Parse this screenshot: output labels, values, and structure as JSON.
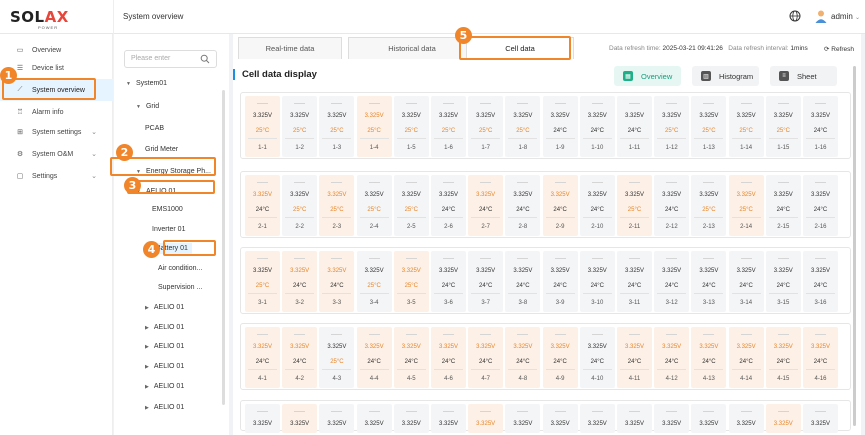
{
  "brand": {
    "name_prefix": "SOL",
    "name_suffix": "AX",
    "tagline": "POWER"
  },
  "header": {
    "page_title": "System overview",
    "user": "admin"
  },
  "sidebar": {
    "items": [
      {
        "label": "Overview",
        "icon": "monitor-icon",
        "has_submenu": false
      },
      {
        "label": "Device list",
        "icon": "list-icon",
        "has_submenu": false
      },
      {
        "label": "System overview",
        "icon": "chart-icon",
        "has_submenu": false
      },
      {
        "label": "Alarm info",
        "icon": "alarm-icon",
        "has_submenu": false
      },
      {
        "label": "System settings",
        "icon": "settings-grid-icon",
        "has_submenu": true
      },
      {
        "label": "System O&M",
        "icon": "maintenance-icon",
        "has_submenu": true
      },
      {
        "label": "Settings",
        "icon": "folder-icon",
        "has_submenu": true
      }
    ]
  },
  "tree": {
    "search_placeholder": "Please enter",
    "nodes": [
      {
        "label": "System01",
        "caret": "▼"
      },
      {
        "label": "Grid",
        "caret": "▼"
      },
      {
        "label": "PCAB",
        "caret": ""
      },
      {
        "label": "Grid Meter",
        "caret": ""
      },
      {
        "label": "Energy Storage Ph...",
        "caret": "▼"
      },
      {
        "label": "AELIO 01",
        "caret": "▼"
      },
      {
        "label": "EMS1000",
        "caret": ""
      },
      {
        "label": "Inverter 01",
        "caret": ""
      },
      {
        "label": "Battery 01",
        "caret": ""
      },
      {
        "label": "Air condition...",
        "caret": ""
      },
      {
        "label": "Supervision ...",
        "caret": ""
      },
      {
        "label": "AELIO 01",
        "caret": "▶"
      },
      {
        "label": "AELIO 01",
        "caret": "▶"
      },
      {
        "label": "AELIO 01",
        "caret": "▶"
      },
      {
        "label": "AELIO 01",
        "caret": "▶"
      },
      {
        "label": "AELIO 01",
        "caret": "▶"
      },
      {
        "label": "AELIO 01",
        "caret": "▶"
      }
    ]
  },
  "tabs": [
    "Real-time data",
    "Historical data",
    "Cell data"
  ],
  "refresh": {
    "time_label": "Data refresh time:",
    "time_value": "2025-03-21 09:41:26",
    "interval_label": "Data refresh interval:",
    "interval_value": "1mins",
    "button": "Refresh"
  },
  "section_title": "Cell data display",
  "views": [
    "Overview",
    "Histogram",
    "Sheet"
  ],
  "step_badges": [
    "1",
    "2",
    "3",
    "4",
    "5"
  ],
  "colors": {
    "accent": "#1a8fe3",
    "highlight": "#f0852a",
    "warning_text": "#e8862a",
    "hot_cell_bg": "#fdf0e6",
    "active_view": "#1fb08a"
  },
  "cells": {
    "voltage": "3.325V",
    "temp_warm": "25°C",
    "temp_normal": "24°C",
    "rows": [
      {
        "hot": [
          1,
          0,
          0,
          1,
          0,
          0,
          0,
          0,
          0,
          0,
          0,
          0,
          0,
          0,
          0,
          0
        ],
        "vwarn": [
          0,
          0,
          0,
          1,
          0,
          0,
          0,
          0,
          0,
          0,
          0,
          0,
          0,
          0,
          0,
          0
        ],
        "twarm": [
          1,
          1,
          1,
          1,
          1,
          1,
          1,
          1,
          0,
          0,
          0,
          1,
          1,
          1,
          1,
          0
        ]
      },
      {
        "hot": [
          1,
          0,
          1,
          0,
          0,
          0,
          1,
          0,
          1,
          0,
          1,
          0,
          0,
          1,
          0,
          0
        ],
        "vwarn": [
          1,
          0,
          1,
          0,
          0,
          0,
          1,
          0,
          1,
          0,
          0,
          0,
          0,
          1,
          0,
          0
        ],
        "twarm": [
          0,
          1,
          1,
          1,
          1,
          0,
          0,
          0,
          0,
          0,
          1,
          0,
          1,
          1,
          0,
          0
        ]
      },
      {
        "hot": [
          1,
          1,
          1,
          0,
          1,
          0,
          0,
          0,
          0,
          0,
          0,
          0,
          0,
          0,
          0,
          0
        ],
        "vwarn": [
          0,
          1,
          1,
          0,
          1,
          0,
          0,
          0,
          0,
          0,
          0,
          0,
          0,
          0,
          0,
          0
        ],
        "twarm": [
          1,
          0,
          0,
          1,
          1,
          0,
          0,
          0,
          0,
          0,
          0,
          0,
          0,
          0,
          0,
          0
        ]
      },
      {
        "hot": [
          1,
          1,
          0,
          1,
          1,
          1,
          1,
          1,
          1,
          0,
          1,
          1,
          1,
          1,
          1,
          1
        ],
        "vwarn": [
          1,
          1,
          0,
          1,
          1,
          1,
          1,
          1,
          1,
          0,
          1,
          1,
          1,
          1,
          1,
          1
        ],
        "twarm": [
          0,
          0,
          1,
          0,
          0,
          0,
          0,
          0,
          0,
          0,
          0,
          0,
          0,
          0,
          0,
          0
        ]
      },
      {
        "hot": [
          0,
          1,
          0,
          0,
          0,
          0,
          1,
          0,
          0,
          0,
          0,
          0,
          0,
          0,
          1,
          0
        ],
        "vwarn": [
          0,
          0,
          0,
          0,
          0,
          0,
          1,
          0,
          0,
          0,
          0,
          0,
          0,
          0,
          1,
          0
        ],
        "twarm": [
          0,
          0,
          0,
          0,
          0,
          0,
          0,
          0,
          0,
          0,
          0,
          0,
          0,
          0,
          0,
          0
        ]
      }
    ]
  }
}
